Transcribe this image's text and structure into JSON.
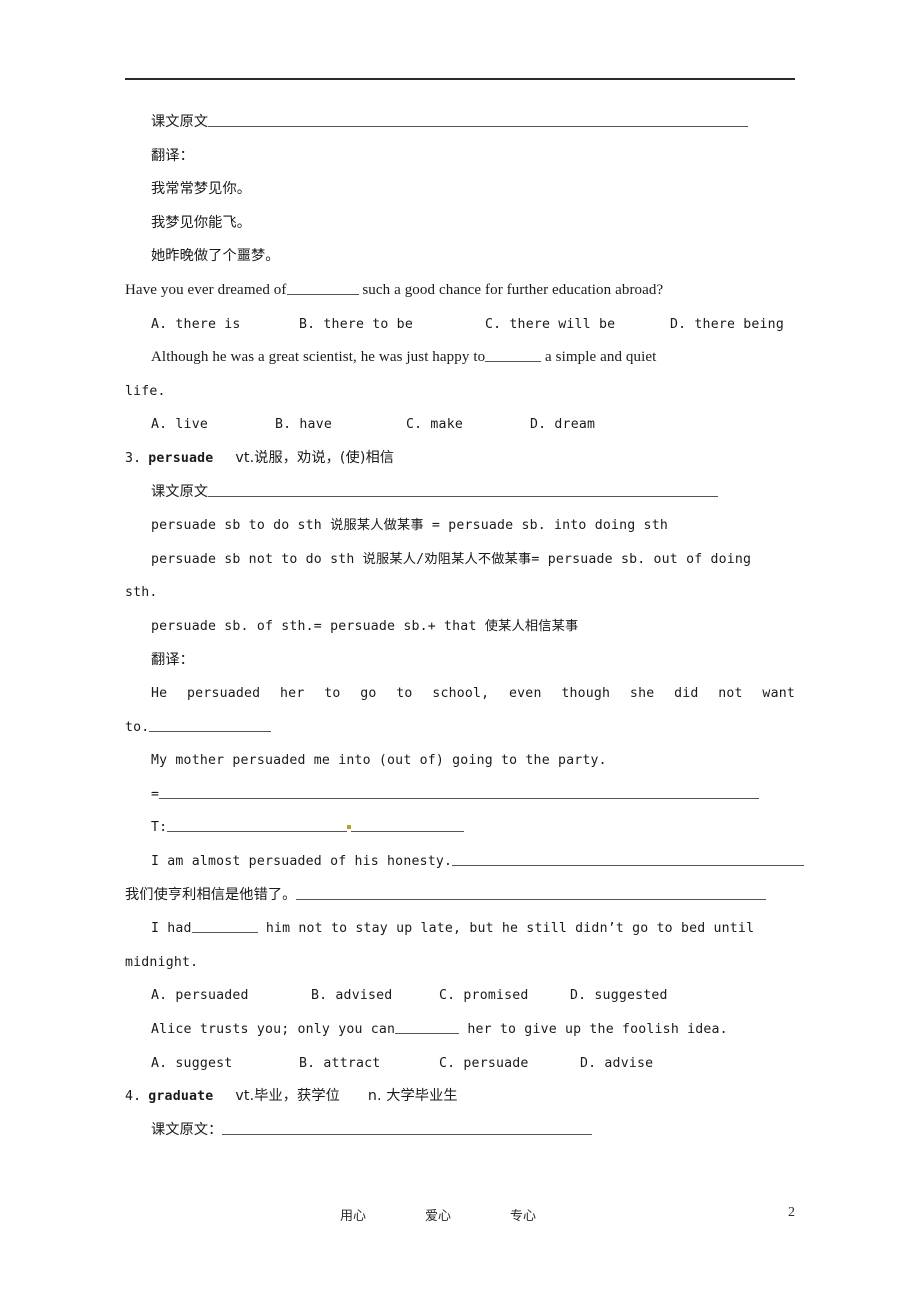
{
  "document": {
    "page_number": "2",
    "footer": {
      "item1": "用心",
      "item2": "爱心",
      "item3": "专心"
    }
  },
  "body": {
    "source_label_1": "课文原文",
    "translate_label_1": "翻译：",
    "sentence_cn_1": "我常常梦见你。",
    "sentence_cn_2": "我梦见你能飞。",
    "sentence_cn_3": "她昨晚做了个噩梦。",
    "question_1_text_a": "Have you ever dreamed of",
    "question_1_text_b": "such a good chance for further education abroad?",
    "question_1_options": {
      "a": "A. there is",
      "b": "B. there to be",
      "c": "C. there will be",
      "d": "D. there being"
    },
    "question_2_text_a": "Although he was a great scientist, he was just happy to",
    "question_2_text_b": "a simple and quiet",
    "question_2_text_c": "life.",
    "question_2_options": {
      "a": "A. live",
      "b": "B. have",
      "c": "C. make",
      "d": "D. dream"
    },
    "entry_3": {
      "number": "3.",
      "word": "persuade",
      "definition": "vt.说服，劝说，(使)相信",
      "source_label": "课文原文",
      "usage_1": "persuade sb  to do sth  说服某人做某事 = persuade sb. into doing sth",
      "usage_2_line1": "persuade sb not to do sth 说服某人/劝阻某人不做某事= persuade sb. out of doing",
      "usage_2_line2": "sth.",
      "usage_3": "persuade sb. of sth.= persuade sb.+ that 使某人相信某事",
      "translate_label": "翻译：",
      "sentence_en_1_line1": "He persuaded her to go to school, even though she did not want",
      "sentence_en_1_line2": "to.",
      "sentence_en_2": "My mother persuaded me into (out of) going to the party.",
      "equals_sign": "=",
      "t_label": "T:",
      "sentence_en_3": "I am almost persuaded of his honesty.",
      "sentence_cn_1": "我们使亨利相信是他错了。",
      "question_3_text_a": "I had",
      "question_3_text_b": "him not to stay up late, but he still didn’t go to bed until",
      "question_3_text_c": "midnight.",
      "question_3_options": {
        "a": "A. persuaded",
        "b": "B. advised",
        "c": "C. promised",
        "d": "D. suggested"
      },
      "question_4_text_a": "Alice trusts you; only you can",
      "question_4_text_b": "her to give up the foolish idea.",
      "question_4_options": {
        "a": "A. suggest",
        "b": "B. attract",
        "c": "C. persuade",
        "d": "D. advise"
      }
    },
    "entry_4": {
      "number": "4.",
      "word": "graduate",
      "definition_vt": "vt.毕业，获学位",
      "definition_n": "n. 大学毕业生",
      "source_label": "课文原文："
    }
  }
}
